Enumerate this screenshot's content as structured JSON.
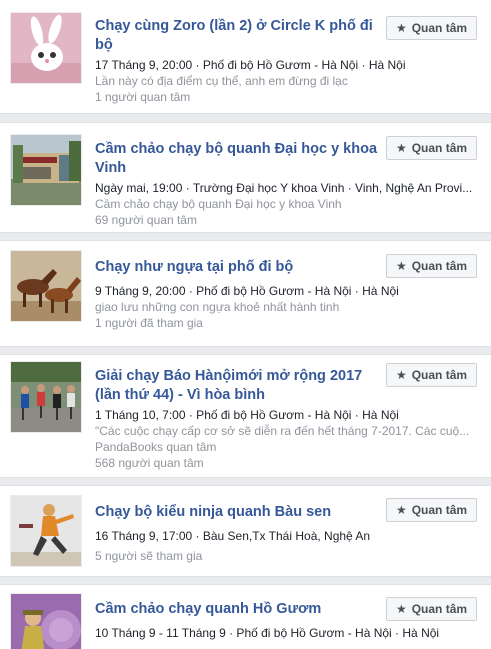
{
  "events": [
    {
      "title": "Chạy cùng Zoro (lần 2) ở Circle K phố đi bộ",
      "meta": "17 Tháng 9, 20:00 · Phố đi bộ Hồ Gươm - Hà Nội · Hà Nội",
      "lines": [
        "Lần này có địa điểm cụ thể, anh em đừng đi lạc",
        "1 người quan tâm"
      ],
      "button": "Quan tâm",
      "thumb": "rabbit-image"
    },
    {
      "title": "Cầm chảo chạy bộ quanh Đại học y khoa Vinh",
      "meta": "Ngày mai, 19:00 · Trường Đại học Y khoa Vinh · Vinh, Nghệ An Provi...",
      "lines": [
        "Cầm chảo chạy bộ quanh Đại học y khoa Vinh",
        "69 người quan tâm"
      ],
      "button": "Quan tâm",
      "thumb": "university-gate-image"
    },
    {
      "title": "Chạy như ngựa tại phố đi bộ",
      "meta": "9 Tháng 9, 20:00 · Phố đi bộ Hồ Gươm - Hà Nội · Hà Nội",
      "lines": [
        "giao lưu những con ngựa khoẻ nhất hành tinh",
        "1 người đã tham gia"
      ],
      "button": "Quan tâm",
      "thumb": "horses-image"
    },
    {
      "title": "Giải chạy Báo Hànộimới mở rộng 2017 (lần thứ 44) - Vì hòa bình",
      "meta": "1 Tháng 10, 7:00 · Phố đi bộ Hồ Gươm - Hà Nội · Hà Nội",
      "lines": [
        "\"Các cuộc chạy cấp cơ sở sẽ diễn ra đến hết tháng 7-2017. Các cuộ...",
        "PandaBooks quan tâm",
        "568 người quan tâm"
      ],
      "button": "Quan tâm",
      "thumb": "runners-image"
    },
    {
      "title": "Chạy bộ kiểu ninja quanh Bàu sen",
      "meta": "16 Tháng 9, 17:00 · Bàu Sen,Tx Thái Hoà, Nghệ An",
      "lines": [
        "5 người sẽ tham gia"
      ],
      "button": "Quan tâm",
      "thumb": "ninja-image"
    },
    {
      "title": "Cầm chảo chạy quanh Hồ Gươm",
      "meta": "10 Tháng 9 - 11 Tháng 9 · Phố đi bộ Hồ Gươm - Hà Nội · Hà Nội",
      "lines": [],
      "button": "Quan tâm",
      "thumb": "pan-warrior-image"
    }
  ]
}
